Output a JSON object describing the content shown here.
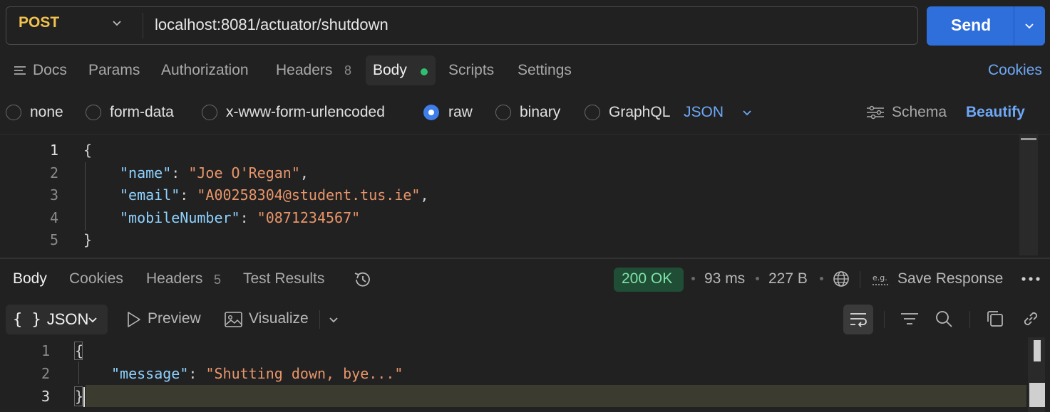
{
  "request": {
    "method": "POST",
    "url": "localhost:8081/actuator/shutdown",
    "send_label": "Send"
  },
  "request_tabs": {
    "docs": "Docs",
    "params": "Params",
    "authorization": "Authorization",
    "headers": "Headers",
    "headers_count": "8",
    "body": "Body",
    "scripts": "Scripts",
    "settings": "Settings",
    "cookies": "Cookies"
  },
  "body_modes": {
    "none": "none",
    "form_data": "form-data",
    "urlencoded": "x-www-form-urlencoded",
    "raw": "raw",
    "binary": "binary",
    "graphql": "GraphQL",
    "selected": "raw",
    "format": "JSON",
    "schema": "Schema",
    "beautify": "Beautify"
  },
  "request_body": {
    "line_numbers": [
      "1",
      "2",
      "3",
      "4",
      "5"
    ],
    "open_brace": "{",
    "close_brace": "}",
    "fields": [
      {
        "key": "\"name\"",
        "value": "\"Joe O'Regan\"",
        "trail": ","
      },
      {
        "key": "\"email\"",
        "value": "\"A00258304@student.tus.ie\"",
        "trail": ","
      },
      {
        "key": "\"mobileNumber\"",
        "value": "\"0871234567\"",
        "trail": ""
      }
    ]
  },
  "response_tabs": {
    "body": "Body",
    "cookies": "Cookies",
    "headers": "Headers",
    "headers_count": "5",
    "test_results": "Test Results"
  },
  "response_meta": {
    "status": "200 OK",
    "time": "93 ms",
    "size": "227 B",
    "save_response": "Save Response"
  },
  "response_view": {
    "format": "JSON",
    "preview": "Preview",
    "visualize": "Visualize"
  },
  "response_body": {
    "line_numbers": [
      "1",
      "2",
      "3"
    ],
    "open_brace": "{",
    "close_brace": "}",
    "key": "\"message\"",
    "value": "\"Shutting down, bye...\""
  },
  "colors": {
    "background": "#212121",
    "accent_blue": "#2f6fdc",
    "method_post": "#f2c14e",
    "status_ok": "#7fe3a8"
  }
}
